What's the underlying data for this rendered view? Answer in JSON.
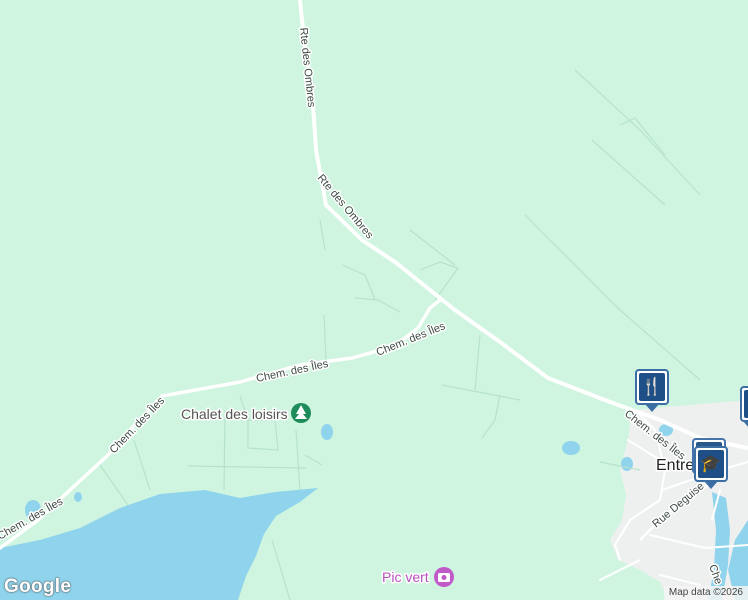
{
  "map": {
    "colors": {
      "land": "#cff5e0",
      "water": "#8fd4ec",
      "road_major": "#ffffff",
      "road_minor": "#ffffff",
      "urban": "#f1f3f4",
      "marker": "#1e4f86"
    },
    "roads": {
      "rte_ombres_top": "Rte des Ombres",
      "rte_ombres_mid": "Rte des Ombres",
      "chem_iles_1": "Chem. des Îles",
      "chem_iles_2": "Chem. des Îles",
      "chem_iles_3": "Chem. des Îles",
      "chem_iles_4": "Chem. des Îles",
      "chem_iles_5": "Chem. des Îles",
      "rue_deguise": "Rue Deguise",
      "che_partial": "Che"
    },
    "places": {
      "chalet": "Chalet des loisirs",
      "pic_vert": "Pic vert",
      "town_partial": "Entre"
    },
    "markers": {
      "restaurant": "restaurant-icon",
      "school": "school-icon"
    },
    "branding": {
      "logo": "Google",
      "attribution": "Map data ©2026"
    }
  }
}
